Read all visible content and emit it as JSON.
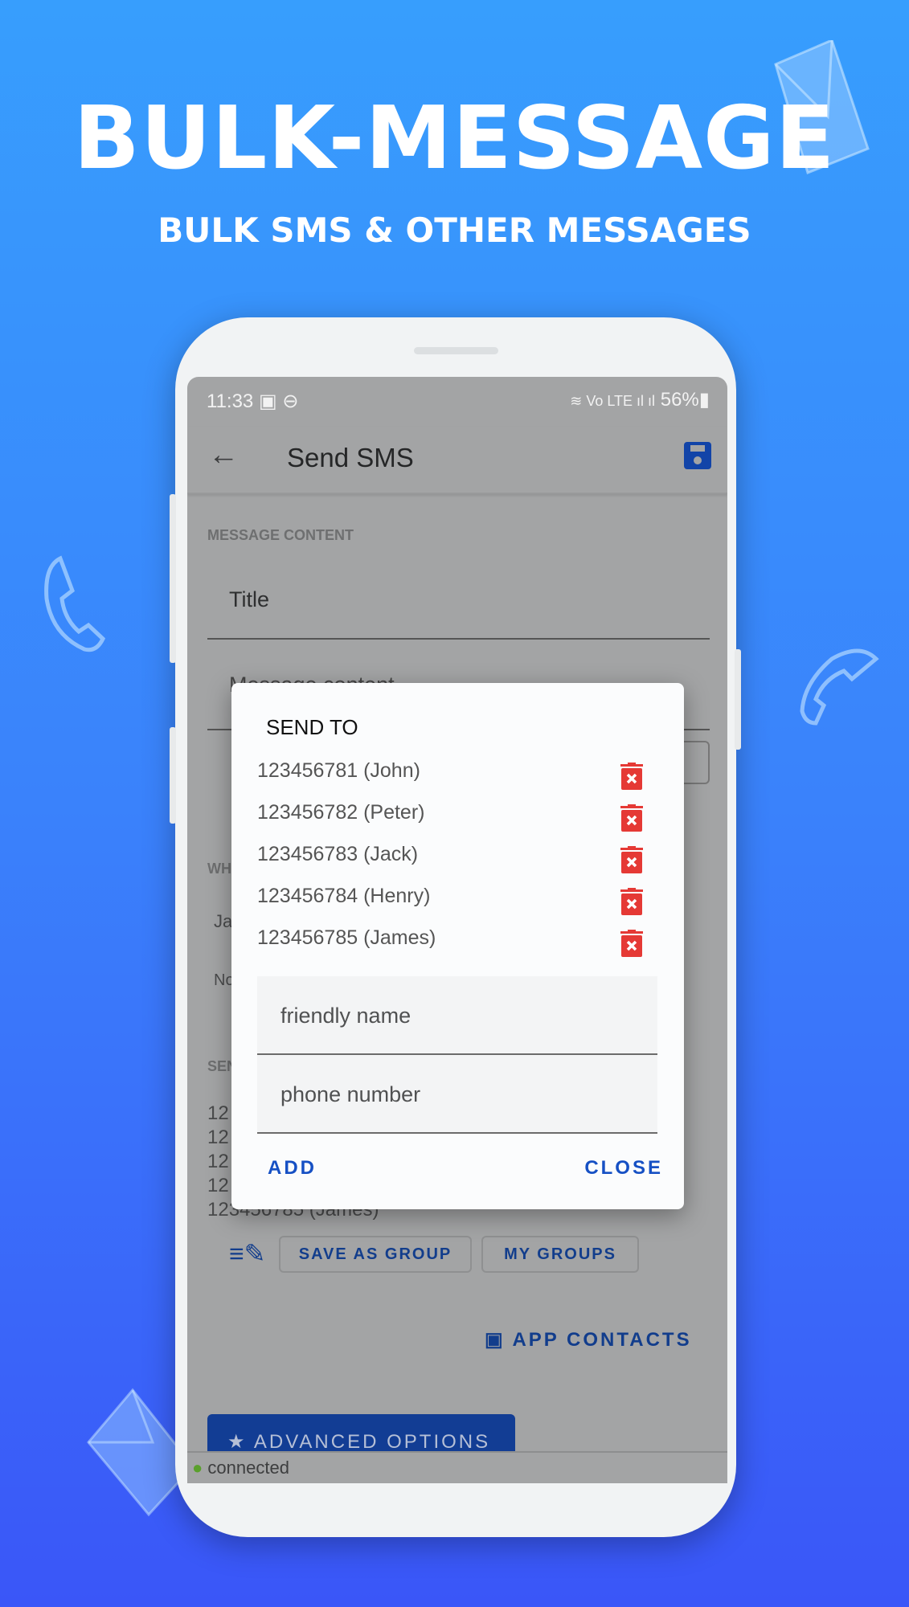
{
  "promo": {
    "headline": "BULK-MESSAGE",
    "subheadline": "BULK SMS & OTHER MESSAGES"
  },
  "status_bar": {
    "time": "11:33",
    "battery": "56%"
  },
  "app_bar": {
    "title": "Send SMS",
    "back_icon": "arrow-left-icon",
    "save_icon": "floppy-disk-icon"
  },
  "background_form": {
    "section_label": "MESSAGE CONTENT",
    "title_placeholder": "Title",
    "message_placeholder": "Message content",
    "when_label": "WH",
    "when_value": "Ja",
    "no_value": "No",
    "send_label": "SEN",
    "recipient_fragments": [
      "12",
      "12",
      "12",
      "12",
      "123456785 (James)"
    ],
    "save_as_group": "SAVE AS GROUP",
    "my_groups": "MY GROUPS",
    "app_contacts": "APP CONTACTS",
    "advanced_options": "ADVANCED OPTIONS",
    "connection_status": "connected"
  },
  "dialog": {
    "title": "SEND TO",
    "recipients": [
      {
        "label": "123456781 (John)"
      },
      {
        "label": "123456782 (Peter)"
      },
      {
        "label": "123456783 (Jack)"
      },
      {
        "label": "123456784 (Henry)"
      },
      {
        "label": "123456785 (James)"
      }
    ],
    "friendly_name_placeholder": "friendly name",
    "phone_number_placeholder": "phone number",
    "add": "ADD",
    "close": "CLOSE"
  },
  "colors": {
    "accent": "#1650c4",
    "delete": "#e53935",
    "connected": "#5aa02c"
  }
}
